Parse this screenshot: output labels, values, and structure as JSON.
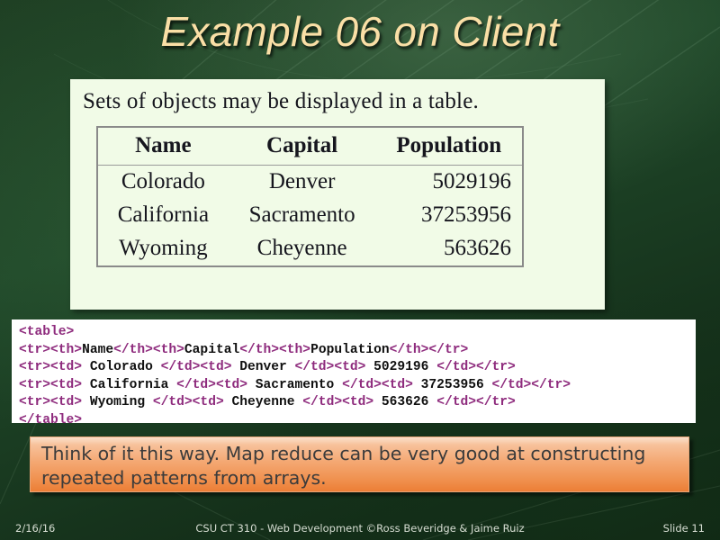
{
  "slide": {
    "title": "Example 06 on Client",
    "background_color": "#1f4024",
    "title_color": "#fadfa6"
  },
  "screenshot_panel": {
    "caption": "Sets of objects may be displayed in a table.",
    "background_color": "#f1fbe7",
    "table": {
      "headers": [
        "Name",
        "Capital",
        "Population"
      ],
      "rows": [
        [
          "Colorado",
          "Denver",
          "5029196"
        ],
        [
          "California",
          "Sacramento",
          "37253956"
        ],
        [
          "Wyoming",
          "Cheyenne",
          "563626"
        ]
      ]
    }
  },
  "code_block": {
    "background_color": "#ffffff",
    "tag_color": "#8e2b7d",
    "text_color": "#101010",
    "lines": [
      [
        {
          "t": "tag",
          "v": "<table>"
        }
      ],
      [
        {
          "t": "tag",
          "v": "<tr><th>"
        },
        {
          "t": "txt",
          "v": "Name"
        },
        {
          "t": "tag",
          "v": "</th><th>"
        },
        {
          "t": "txt",
          "v": "Capital"
        },
        {
          "t": "tag",
          "v": "</th><th>"
        },
        {
          "t": "txt",
          "v": "Population"
        },
        {
          "t": "tag",
          "v": "</th></tr>"
        }
      ],
      [
        {
          "t": "tag",
          "v": "<tr><td>"
        },
        {
          "t": "txt",
          "v": " Colorado "
        },
        {
          "t": "tag",
          "v": "</td><td>"
        },
        {
          "t": "txt",
          "v": " Denver "
        },
        {
          "t": "tag",
          "v": "</td><td>"
        },
        {
          "t": "txt",
          "v": " 5029196 "
        },
        {
          "t": "tag",
          "v": "</td></tr>"
        }
      ],
      [
        {
          "t": "tag",
          "v": "<tr><td>"
        },
        {
          "t": "txt",
          "v": " California "
        },
        {
          "t": "tag",
          "v": "</td><td>"
        },
        {
          "t": "txt",
          "v": " Sacramento "
        },
        {
          "t": "tag",
          "v": "</td><td>"
        },
        {
          "t": "txt",
          "v": " 37253956 "
        },
        {
          "t": "tag",
          "v": "</td></tr>"
        }
      ],
      [
        {
          "t": "tag",
          "v": "<tr><td>"
        },
        {
          "t": "txt",
          "v": " Wyoming "
        },
        {
          "t": "tag",
          "v": "</td><td>"
        },
        {
          "t": "txt",
          "v": " Cheyenne "
        },
        {
          "t": "tag",
          "v": "</td><td>"
        },
        {
          "t": "txt",
          "v": " 563626 "
        },
        {
          "t": "tag",
          "v": "</td></tr>"
        }
      ],
      [
        {
          "t": "tag",
          "v": "</table>"
        }
      ]
    ]
  },
  "callout": {
    "text": "Think of it this way. Map reduce can be very good at constructing repeated patterns from arrays.",
    "background_color": "#f4a873",
    "text_color": "#3b3b3b"
  },
  "footer": {
    "date": "2/16/16",
    "center": "CSU CT 310 - Web Development ©Ross Beveridge & Jaime Ruiz",
    "slide_number": "Slide 11"
  }
}
